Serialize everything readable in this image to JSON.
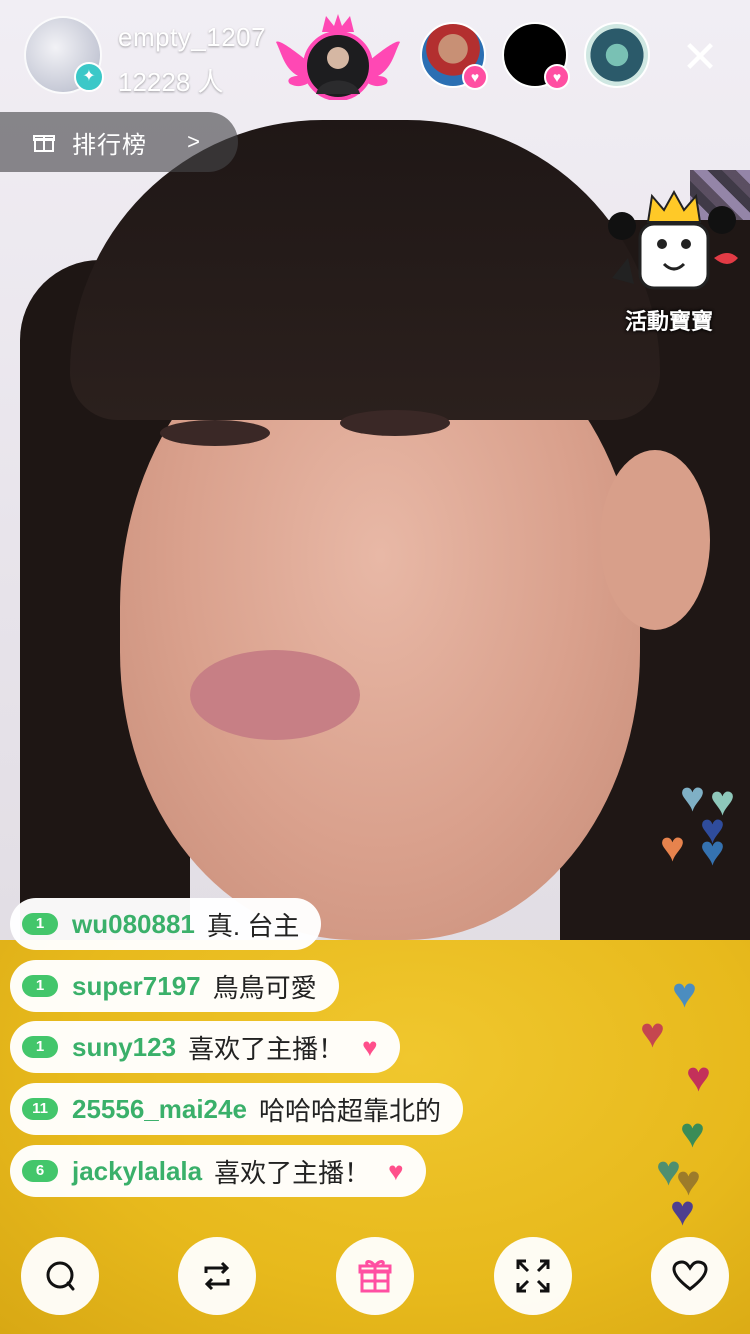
{
  "host": {
    "name": "empty_1207",
    "viewer_count": "12228 人"
  },
  "leaderboard": {
    "label": "排行榜"
  },
  "event": {
    "label": "活動寶寶"
  },
  "chat": [
    {
      "level": "1",
      "user": "wu080881",
      "message": "真. 台主",
      "heart": false
    },
    {
      "level": "1",
      "user": "super7197",
      "message": "鳥鳥可愛",
      "heart": false
    },
    {
      "level": "1",
      "user": "suny123",
      "message": "喜欢了主播！",
      "heart": true
    },
    {
      "level": "11",
      "user": "25556_mai24e",
      "message": "哈哈哈超靠北的",
      "heart": false
    },
    {
      "level": "6",
      "user": "jackylalala",
      "message": "喜欢了主播！",
      "heart": true
    }
  ],
  "colors": {
    "accent": "#ff4fa2",
    "username": "#3ab06a",
    "level_badge": "#43c66b"
  },
  "icons": {
    "chat": "chat-bubble-icon",
    "share": "repeat-icon",
    "gift": "gift-icon",
    "fullscreen": "expand-icon",
    "like": "heart-icon",
    "close": "close-icon"
  }
}
